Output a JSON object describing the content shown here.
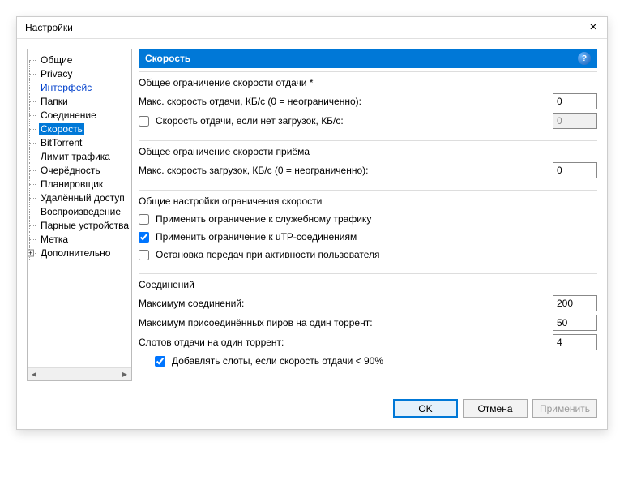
{
  "window": {
    "title": "Настройки"
  },
  "tree": {
    "items": [
      {
        "label": "Общие"
      },
      {
        "label": "Privacy"
      },
      {
        "label": "Интерфейс",
        "link": true
      },
      {
        "label": "Папки"
      },
      {
        "label": "Соединение"
      },
      {
        "label": "Скорость",
        "selected": true
      },
      {
        "label": "BitTorrent"
      },
      {
        "label": "Лимит трафика"
      },
      {
        "label": "Очерёдность"
      },
      {
        "label": "Планировщик"
      },
      {
        "label": "Удалённый доступ"
      },
      {
        "label": "Воспроизведение"
      },
      {
        "label": "Парные устройства"
      },
      {
        "label": "Метка"
      },
      {
        "label": "Дополнительно",
        "expandable": true
      }
    ]
  },
  "header": {
    "title": "Скорость"
  },
  "sections": {
    "upload": {
      "title": "Общее ограничение скорости отдачи *",
      "max_label": "Макс. скорость отдачи, КБ/с (0 = неограниченно):",
      "max_value": "0",
      "alt_check": false,
      "alt_label": "Скорость отдачи, если нет загрузок, КБ/с:",
      "alt_value": "0"
    },
    "download": {
      "title": "Общее ограничение скорости приёма",
      "max_label": "Макс. скорость загрузок, КБ/с (0 = неограниченно):",
      "max_value": "0"
    },
    "options": {
      "title": "Общие настройки ограничения скорости",
      "opt1_check": false,
      "opt1_label": "Применить ограничение к служебному трафику",
      "opt2_check": true,
      "opt2_label": "Применить ограничение к uTP-соединениям",
      "opt3_check": false,
      "opt3_label": "Остановка передач при активности пользователя"
    },
    "conn": {
      "title": "Соединений",
      "max_conn_label": "Максимум соединений:",
      "max_conn_value": "200",
      "max_peers_label": "Максимум присоединённых пиров на один торрент:",
      "max_peers_value": "50",
      "slots_label": "Слотов отдачи на один торрент:",
      "slots_value": "4",
      "add_slots_check": true,
      "add_slots_label": "Добавлять слоты, если скорость отдачи < 90%"
    }
  },
  "footer": {
    "ok": "OK",
    "cancel": "Отмена",
    "apply": "Применить"
  }
}
